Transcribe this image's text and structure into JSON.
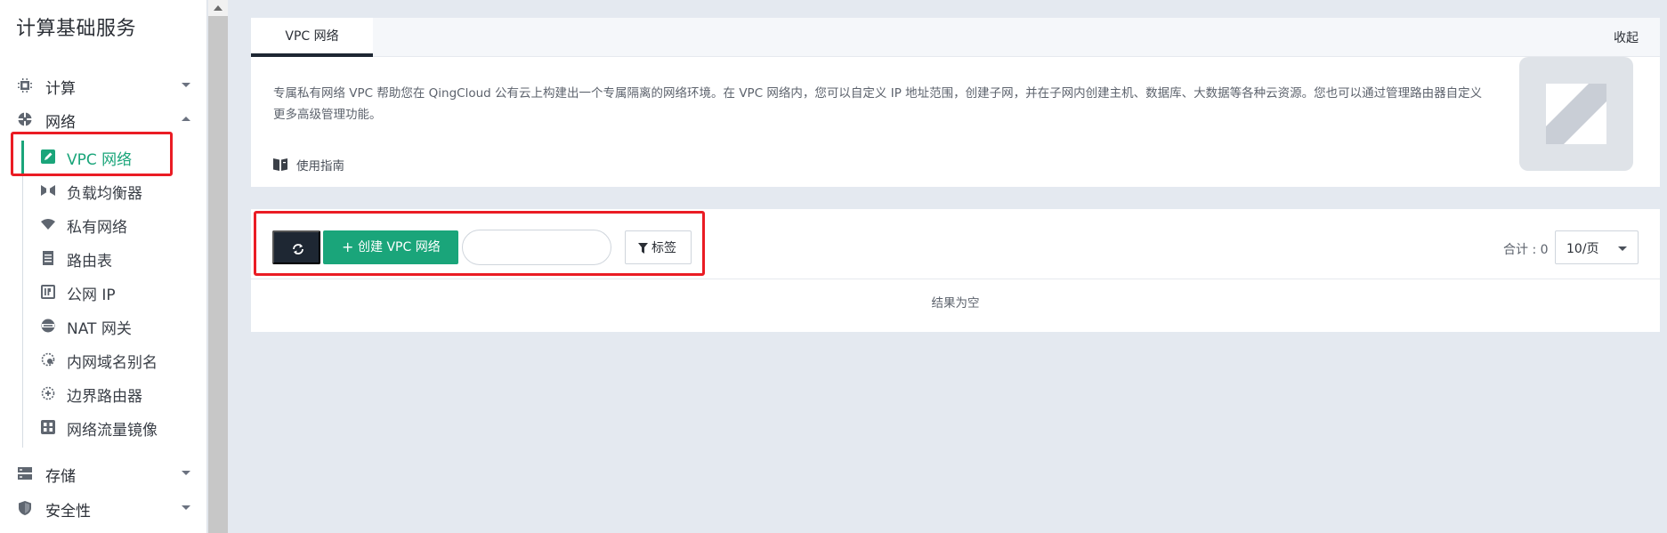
{
  "sidebar": {
    "title": "计算基础服务",
    "groups": [
      {
        "label": "计算",
        "icon": "cpu-icon",
        "expanded": false
      },
      {
        "label": "网络",
        "icon": "network-icon",
        "expanded": true
      },
      {
        "label": "存储",
        "icon": "storage-icon",
        "expanded": false
      },
      {
        "label": "安全性",
        "icon": "shield-icon",
        "expanded": false
      }
    ],
    "network_items": [
      {
        "label": "VPC 网络",
        "icon": "vpc-pencil-icon",
        "active": true
      },
      {
        "label": "负载均衡器",
        "icon": "load-balancer-icon"
      },
      {
        "label": "私有网络",
        "icon": "wifi-icon"
      },
      {
        "label": "路由表",
        "icon": "route-table-icon"
      },
      {
        "label": "公网 IP",
        "icon": "ip-icon"
      },
      {
        "label": "NAT 网关",
        "icon": "nat-gateway-icon"
      },
      {
        "label": "内网域名别名",
        "icon": "dns-alias-icon"
      },
      {
        "label": "边界路由器",
        "icon": "border-router-icon"
      },
      {
        "label": "网络流量镜像",
        "icon": "traffic-mirror-icon"
      }
    ]
  },
  "intro": {
    "tab_label": "VPC 网络",
    "collapse_label": "收起",
    "description": "专属私有网络 VPC 帮助您在 QingCloud 公有云上构建出一个专属隔离的网络环境。在 VPC 网络内，您可以自定义 IP 地址范围，创建子网，并在子网内创建主机、数据库、大数据等各种云资源。您也可以通过管理路由器自定义更多高级管理功能。",
    "guide_label": "使用指南"
  },
  "toolbar": {
    "create_plus": "+",
    "create_label": "创建 VPC 网络",
    "search_value": "",
    "tag_label": "标签",
    "total_label": "合计 : 0",
    "page_size": "10/页"
  },
  "table": {
    "empty_text": "结果为空"
  },
  "colors": {
    "accent": "#1aa57a",
    "dark": "#1e2733",
    "highlight": "#ea1c24"
  }
}
